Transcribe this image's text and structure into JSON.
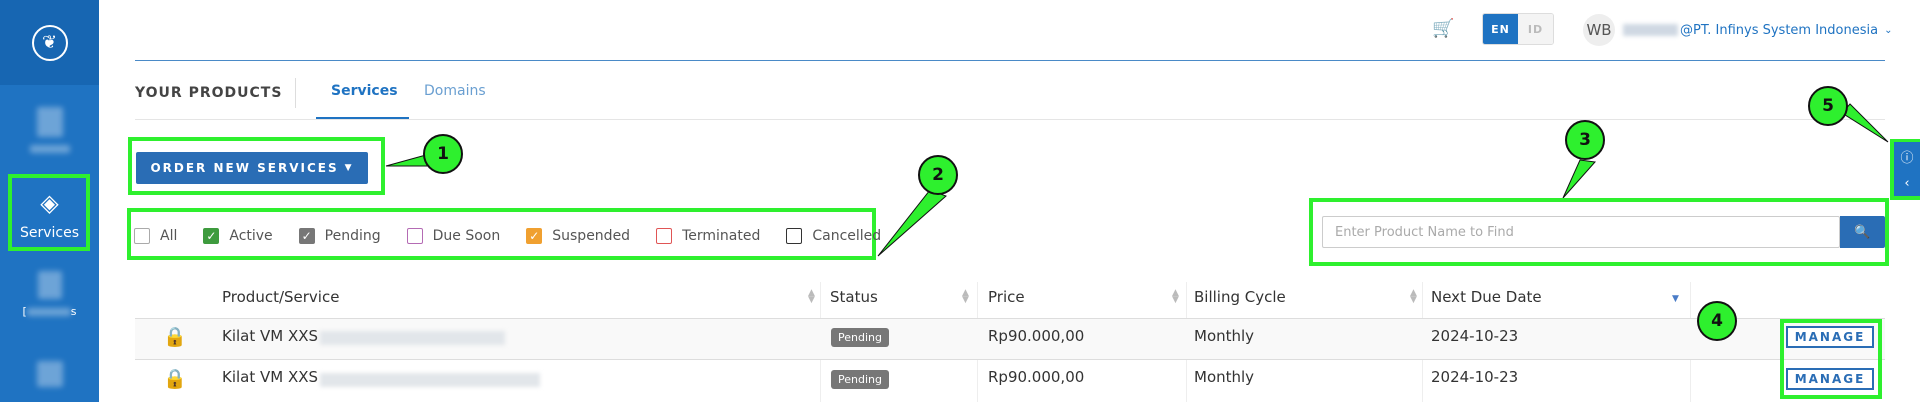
{
  "header": {
    "language": {
      "en": "EN",
      "id": "ID"
    },
    "user": {
      "initials": "WB",
      "org": "@PT. Infinys System Indonesia"
    }
  },
  "sidebar": {
    "active_label": "Services",
    "partial_label_b": "[",
    "partial_label_c": "s"
  },
  "page": {
    "title": "YOUR PRODUCTS",
    "tabs": [
      "Services",
      "Domains"
    ],
    "order_button": "ORDER NEW SERVICES"
  },
  "filters": [
    {
      "label": "All",
      "checked": false,
      "color": "#bbbbbb"
    },
    {
      "label": "Active",
      "checked": true,
      "color": "#3e9b3e"
    },
    {
      "label": "Pending",
      "checked": true,
      "color": "#777777"
    },
    {
      "label": "Due Soon",
      "checked": false,
      "color": "#b46bb4"
    },
    {
      "label": "Suspended",
      "checked": true,
      "color": "#f0a030"
    },
    {
      "label": "Terminated",
      "checked": false,
      "color": "#e05555"
    },
    {
      "label": "Cancelled",
      "checked": false,
      "color": "#333333"
    }
  ],
  "search": {
    "placeholder": "Enter Product Name to Find"
  },
  "table": {
    "columns": [
      "Product/Service",
      "Status",
      "Price",
      "Billing Cycle",
      "Next Due Date"
    ],
    "rows": [
      {
        "product": "Kilat VM XXS",
        "status": "Pending",
        "price": "Rp90.000,00",
        "cycle": "Monthly",
        "due": "2024-10-23",
        "action": "MANAGE"
      },
      {
        "product": "Kilat VM XXS",
        "status": "Pending",
        "price": "Rp90.000,00",
        "cycle": "Monthly",
        "due": "2024-10-23",
        "action": "MANAGE"
      }
    ]
  },
  "annotations": [
    "1",
    "2",
    "3",
    "4",
    "5"
  ],
  "colors": {
    "accent": "#1f73c2",
    "highlight": "#2ef02e"
  }
}
